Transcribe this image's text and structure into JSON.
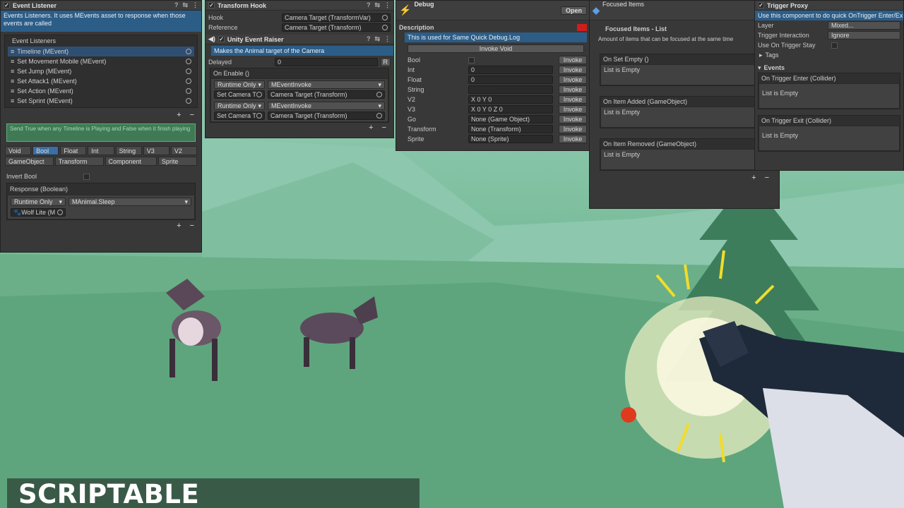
{
  "event_listener": {
    "title": "Event Listener",
    "info": "Events Listeners. It uses MEvents asset to response when those events are called",
    "list_title": "Event Listeners",
    "items": [
      "Timeline (MEvent)",
      "Set Movement Mobile (MEvent)",
      "Set Jump (MEvent)",
      "Set Attack1 (MEvent)",
      "Set Action (MEvent)",
      "Set Sprint (MEvent)"
    ],
    "hint": "Send True when any Timeline is Playing and False when it finish playing",
    "tabs_row1": [
      "Void",
      "Bool",
      "Float",
      "Int",
      "String",
      "V3",
      "V2"
    ],
    "tabs_row2": [
      "GameObject",
      "Transform",
      "Component",
      "Sprite"
    ],
    "invert_label": "Invert Bool",
    "response_label": "Response (Boolean)",
    "runtime": "Runtime Only",
    "method": "MAnimal.Sleep",
    "target": "Wolf Lite (M"
  },
  "transform_hook": {
    "title": "Transform Hook",
    "hook_label": "Hook",
    "hook_value": "Camera Target (TransformVar)",
    "ref_label": "Reference",
    "ref_value": "Camera Target (Transform)"
  },
  "unity_event_raiser": {
    "title": "Unity Event Raiser",
    "description": "Makes the Animal target of the Camera",
    "delayed_label": "Delayed",
    "delayed_value": "0",
    "r_button": "R",
    "on_enable": "On Enable ()",
    "rows": [
      {
        "runtime": "Runtime Only",
        "method": "MEventInvoke",
        "obj": "Set Camera T",
        "target": "Camera Target (Transform)"
      },
      {
        "runtime": "Runtime Only",
        "method": "MEventInvoke",
        "obj": "Set Camera T",
        "target": "Camera Target (Transform)"
      }
    ]
  },
  "debug": {
    "title": "Debug",
    "open": "Open",
    "description_label": "Description",
    "description": "This is used for Same Quick Debug.Log",
    "invoke_void": "Invoke Void",
    "invoke": "Invoke",
    "rows": [
      {
        "label": "Bool",
        "value": ""
      },
      {
        "label": "Int",
        "value": "0"
      },
      {
        "label": "Float",
        "value": "0"
      },
      {
        "label": "String",
        "value": ""
      },
      {
        "label": "V2",
        "value": "X 0        Y 0"
      },
      {
        "label": "V3",
        "value": "X 0      Y 0      Z 0"
      },
      {
        "label": "Go",
        "value": "None (Game Object)"
      },
      {
        "label": "Transform",
        "value": "None (Transform)"
      },
      {
        "label": "Sprite",
        "value": "None (Sprite)"
      }
    ]
  },
  "focused_items": {
    "title": "Focused Items",
    "list_title": "Focused Items - List",
    "amount": "Amount of items that can be focused at the same time",
    "events": [
      "On Set Empty ()",
      "On Item Added (GameObject)",
      "On Item Removed (GameObject)"
    ],
    "empty": "List is Empty"
  },
  "trigger_proxy": {
    "title": "Trigger Proxy",
    "info": "Use this component to do quick OnTrigger Enter/Exit",
    "layer_label": "Layer",
    "layer_value": "Mixed...",
    "interaction_label": "Trigger Interaction",
    "interaction_value": "Ignore",
    "stay_label": "Use On Trigger Stay",
    "tags_label": "Tags",
    "events_label": "Events",
    "enter": "On Trigger Enter (Collider)",
    "exit": "On Trigger Exit (Collider)",
    "empty": "List is Empty"
  },
  "caption": "SCRIPTABLE ARCHITECTURE",
  "colors": {
    "panel": "#383838",
    "accent_blue": "#2c5d87",
    "selected_tab": "#3b6ea5",
    "hint_green": "#3f7a54"
  }
}
